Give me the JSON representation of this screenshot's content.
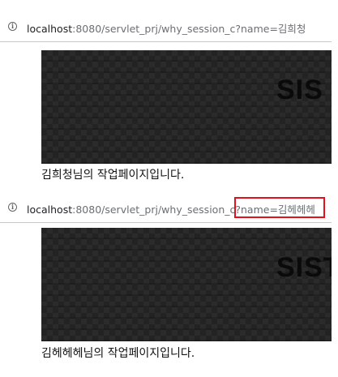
{
  "screens": [
    {
      "url": {
        "host": "localhost",
        "rest": ":8080/servlet_prj/why_session_c?name=김희청"
      },
      "banner_text": "SIS",
      "message": "김희청님의 작업페이지입니다."
    },
    {
      "url": {
        "host": "localhost",
        "rest": ":8080/servlet_prj/why_session_c?name=김헤헤헤"
      },
      "banner_text": "SIST",
      "message": "김헤헤헤님의 작업페이지입니다."
    }
  ],
  "colors": {
    "highlight": "#e2111b",
    "banner_background": "#232323"
  }
}
